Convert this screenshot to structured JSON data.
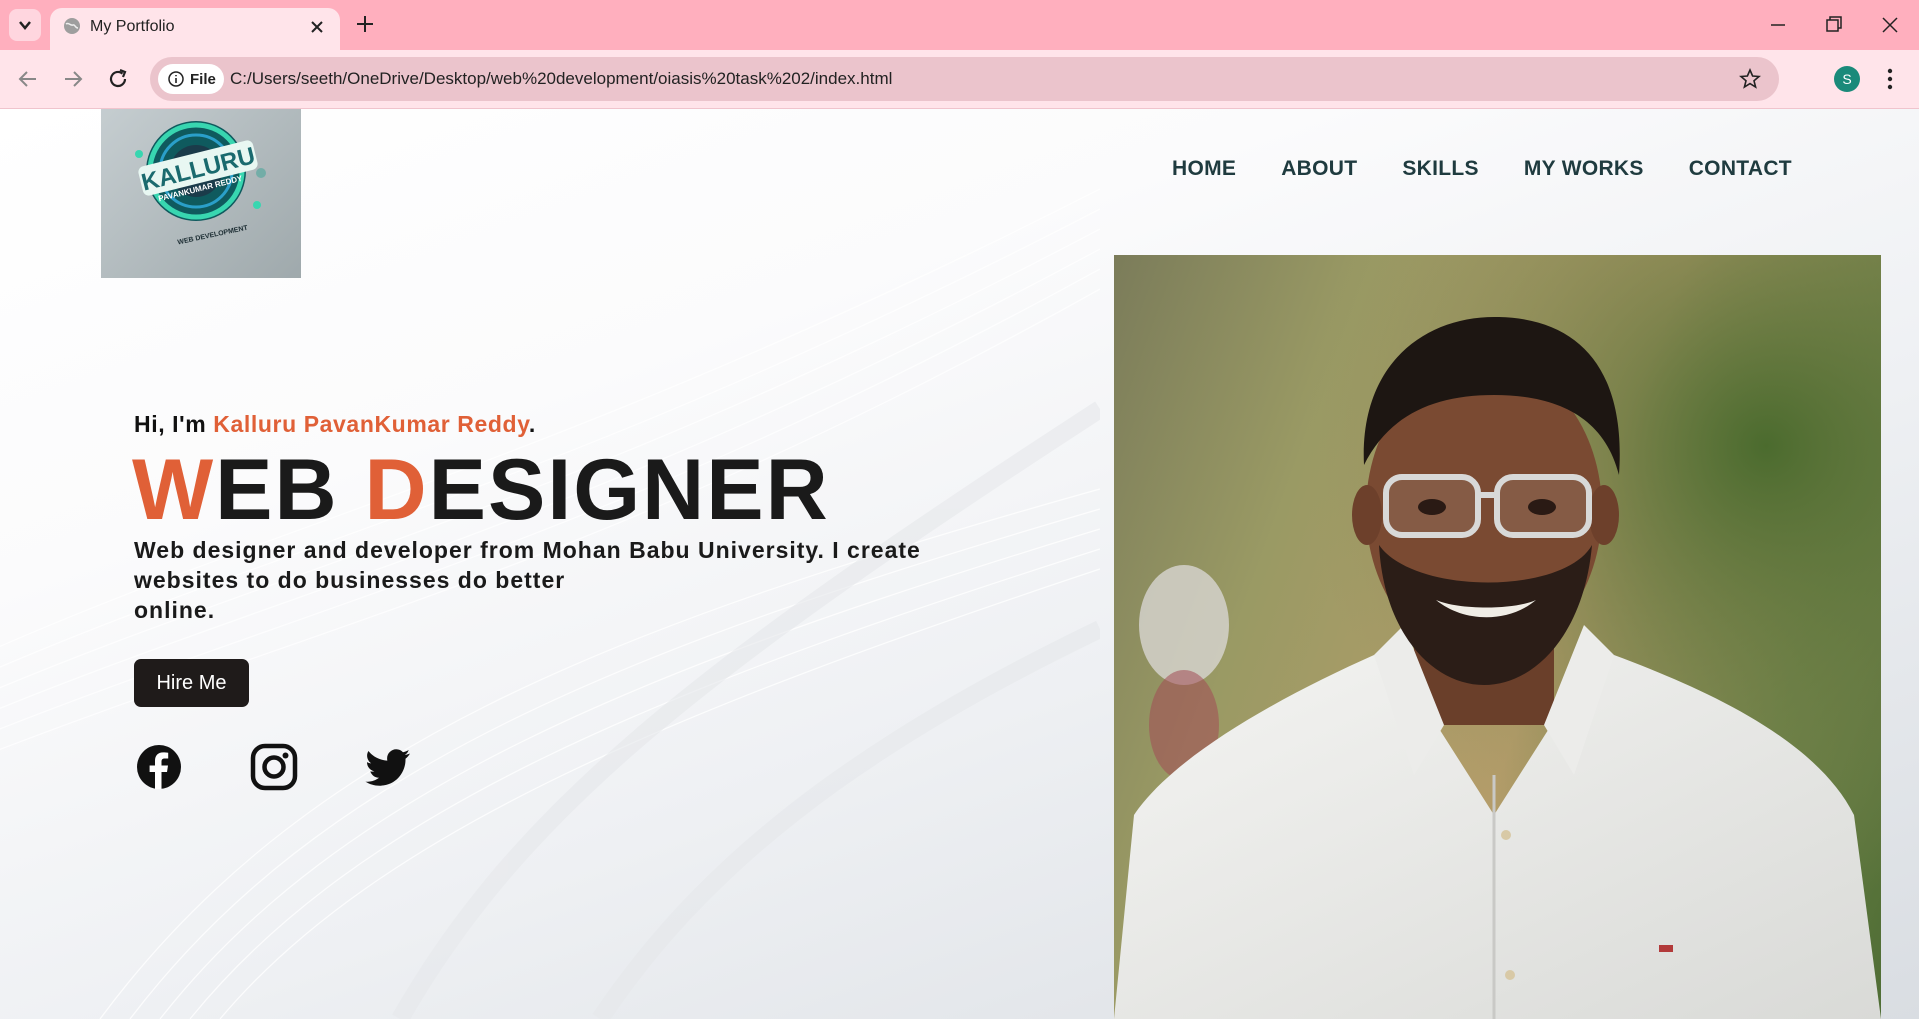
{
  "browser": {
    "tab_title": "My Portfolio",
    "url": "C:/Users/seeth/OneDrive/Desktop/web%20development/oiasis%20task%202/index.html",
    "site_info_label": "File",
    "profile_initial": "S"
  },
  "page": {
    "logo": {
      "brand": "KALLURU",
      "sub": "PAVANKUMAR REDDY",
      "tag": "WEB DEVELOPMENT"
    },
    "nav": [
      "HOME",
      "ABOUT",
      "SKILLS",
      "MY WORKS",
      "CONTACT"
    ],
    "hero": {
      "greeting_prefix": "Hi, I'm ",
      "name": "Kalluru PavanKumar Reddy",
      "greeting_suffix": ".",
      "headline": {
        "w": "W",
        "eb": "EB ",
        "d": "D",
        "esigner": "ESIGNER"
      },
      "description_lines": [
        "Web designer and developer from Mohan Babu University. I create",
        "websites to do businesses do better",
        "online."
      ],
      "cta": "Hire Me"
    },
    "social": [
      "facebook-icon",
      "instagram-icon",
      "twitter-icon"
    ],
    "colors": {
      "accent": "#e06037",
      "nav": "#1f3b3f",
      "button": "#1f1b1a",
      "chrome": "#ffafbe"
    }
  }
}
